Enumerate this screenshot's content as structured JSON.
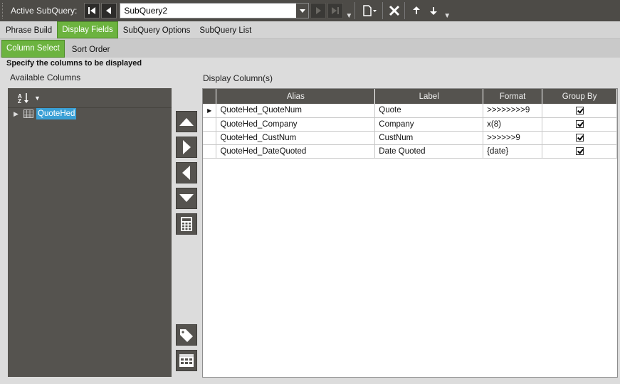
{
  "toolbar": {
    "active_label": "Active SubQuery:",
    "subquery_value": "SubQuery2"
  },
  "tabs_main": [
    {
      "label": "Phrase Build",
      "active": false
    },
    {
      "label": "Display Fields",
      "active": true
    },
    {
      "label": "SubQuery Options",
      "active": false
    },
    {
      "label": "SubQuery List",
      "active": false
    }
  ],
  "tabs_sub": [
    {
      "label": "Column Select",
      "active": true
    },
    {
      "label": "Sort Order",
      "active": false
    }
  ],
  "instruction": "Specify the columns to be displayed",
  "available": {
    "label": "Available Columns",
    "tree_node": "QuoteHed"
  },
  "display": {
    "label": "Display Column(s)",
    "columns": [
      "Alias",
      "Label",
      "Format",
      "Group By"
    ],
    "rows": [
      {
        "alias": "QuoteHed_QuoteNum",
        "label": "Quote",
        "format": ">>>>>>>>9",
        "group_by": true,
        "current": true
      },
      {
        "alias": "QuoteHed_Company",
        "label": "Company",
        "format": "x(8)",
        "group_by": true,
        "current": false
      },
      {
        "alias": "QuoteHed_CustNum",
        "label": "CustNum",
        "format": ">>>>>>9",
        "group_by": true,
        "current": false
      },
      {
        "alias": "QuoteHed_DateQuoted",
        "label": "Date Quoted",
        "format": "{date}",
        "group_by": true,
        "current": false
      }
    ]
  },
  "colors": {
    "accent_green": "#6cb33f",
    "dark_panel": "#55534f",
    "selection_blue": "#3aa0d6"
  }
}
